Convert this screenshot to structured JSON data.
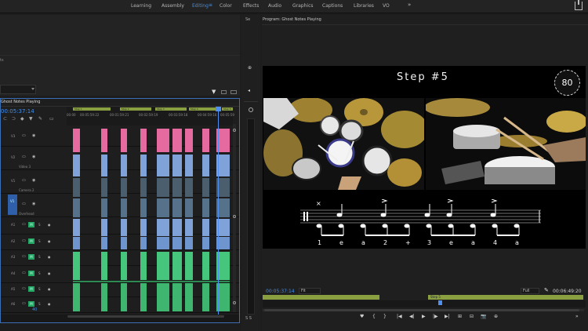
{
  "workspaces": [
    "Learning",
    "Assembly",
    "Editing",
    "Color",
    "Effects",
    "Audio",
    "Graphics",
    "Captions",
    "Libraries",
    "VO"
  ],
  "active_workspace": "Editing",
  "workspace_menu_glyph": "≡",
  "more_glyph": "»",
  "left_panel": {
    "label_fragment": "ts"
  },
  "middle_panel": {
    "label": "Se",
    "meter_label": "S S"
  },
  "timeline": {
    "title": "Ghost Notes Playing",
    "timecode": "00:05:37:14",
    "ruler_marks": [
      "00:00",
      "00:05:59:22",
      "00:01:59:21",
      "00:02:59:19",
      "00:03:59:18",
      "00:04:59:16",
      "00:05:59"
    ],
    "sections": [
      "Step 1",
      "Step 2",
      "Step 3",
      "Step 4",
      "Step 5"
    ],
    "tracks": [
      {
        "id": "V3",
        "label": ""
      },
      {
        "id": "V2",
        "label": "Video 3"
      },
      {
        "id": "V1",
        "label": "Camera 2"
      },
      {
        "id": "V1",
        "label": "Overhead",
        "target": "V1"
      },
      {
        "id": "A1",
        "label": ""
      },
      {
        "id": "A2",
        "label": ""
      },
      {
        "id": "A3",
        "label": ""
      },
      {
        "id": "A4",
        "label": ""
      },
      {
        "id": "A5",
        "label": ""
      },
      {
        "id": "A6",
        "label": ""
      }
    ],
    "mute_label": "M",
    "solo_label": "S",
    "bottom_value": "40"
  },
  "program": {
    "title": "Program: Ghost Notes Playing",
    "overlay_title": "Step #5",
    "tempo": "80",
    "counts": [
      "1",
      "e",
      "a",
      "2",
      "+",
      "3",
      "e",
      "a",
      "4",
      "a"
    ],
    "timecode": "00:05:37:14",
    "fit": "Fit",
    "quality": "Full",
    "duration": "00:06:49:20",
    "section_label": "Step 5",
    "controls": [
      "♥",
      "{",
      "}",
      "|◀",
      "◀|",
      "▶",
      "|▶",
      "▶|",
      "⊞",
      "⊟",
      "📷",
      "⊕",
      "»"
    ]
  },
  "colors": {
    "accent": "#3f8ff0",
    "section": "#8aa040",
    "pink_clip": "#e46aa0",
    "video_clip": "#7fa2d8",
    "audio_clip": "#46c67c"
  }
}
